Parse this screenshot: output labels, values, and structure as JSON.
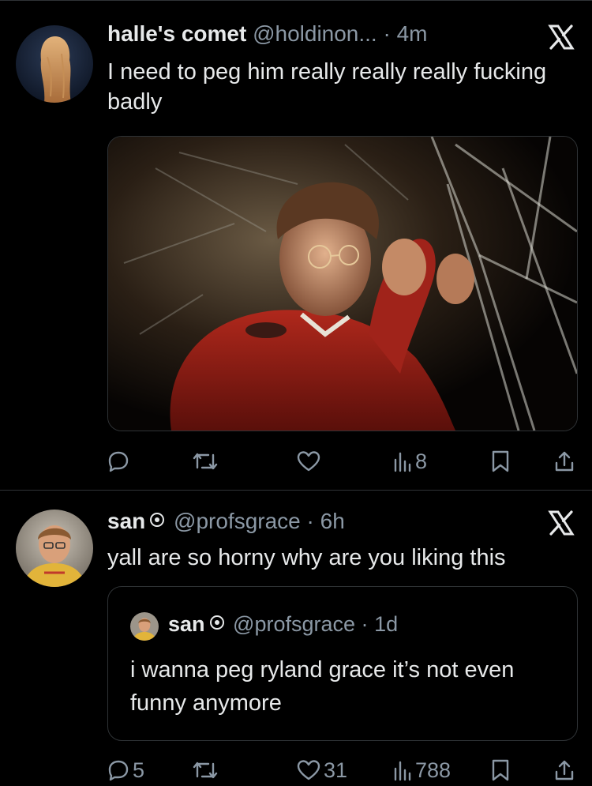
{
  "tweets": [
    {
      "display_name": "halle's comet",
      "handle": "@holdinon...",
      "separator": "·",
      "time": "4m",
      "text": "I need to peg him really really really fucking badly",
      "media_description": "man in red jacket with glasses",
      "actions": {
        "reply_count": "",
        "retweet_count": "",
        "like_count": "",
        "view_count": "8"
      }
    },
    {
      "display_name": "san",
      "handle": "@profsgrace",
      "separator": "·",
      "time": "6h",
      "text": "yall are so horny why are you liking this",
      "quote": {
        "display_name": "san",
        "handle": "@profsgrace",
        "separator": "·",
        "time": "1d",
        "text": "i wanna peg ryland grace it’s not even funny anymore"
      },
      "actions": {
        "reply_count": "5",
        "retweet_count": "",
        "like_count": "31",
        "view_count": "788"
      }
    }
  ],
  "colors": {
    "background": "#000000",
    "primary_text": "#e7e9ea",
    "secondary_text": "#8b98a5",
    "border": "#2f3336"
  },
  "icons": [
    "reply-icon",
    "retweet-icon",
    "like-icon",
    "views-icon",
    "bookmark-icon",
    "share-icon",
    "x-logo-icon",
    "verified-badge-icon"
  ]
}
